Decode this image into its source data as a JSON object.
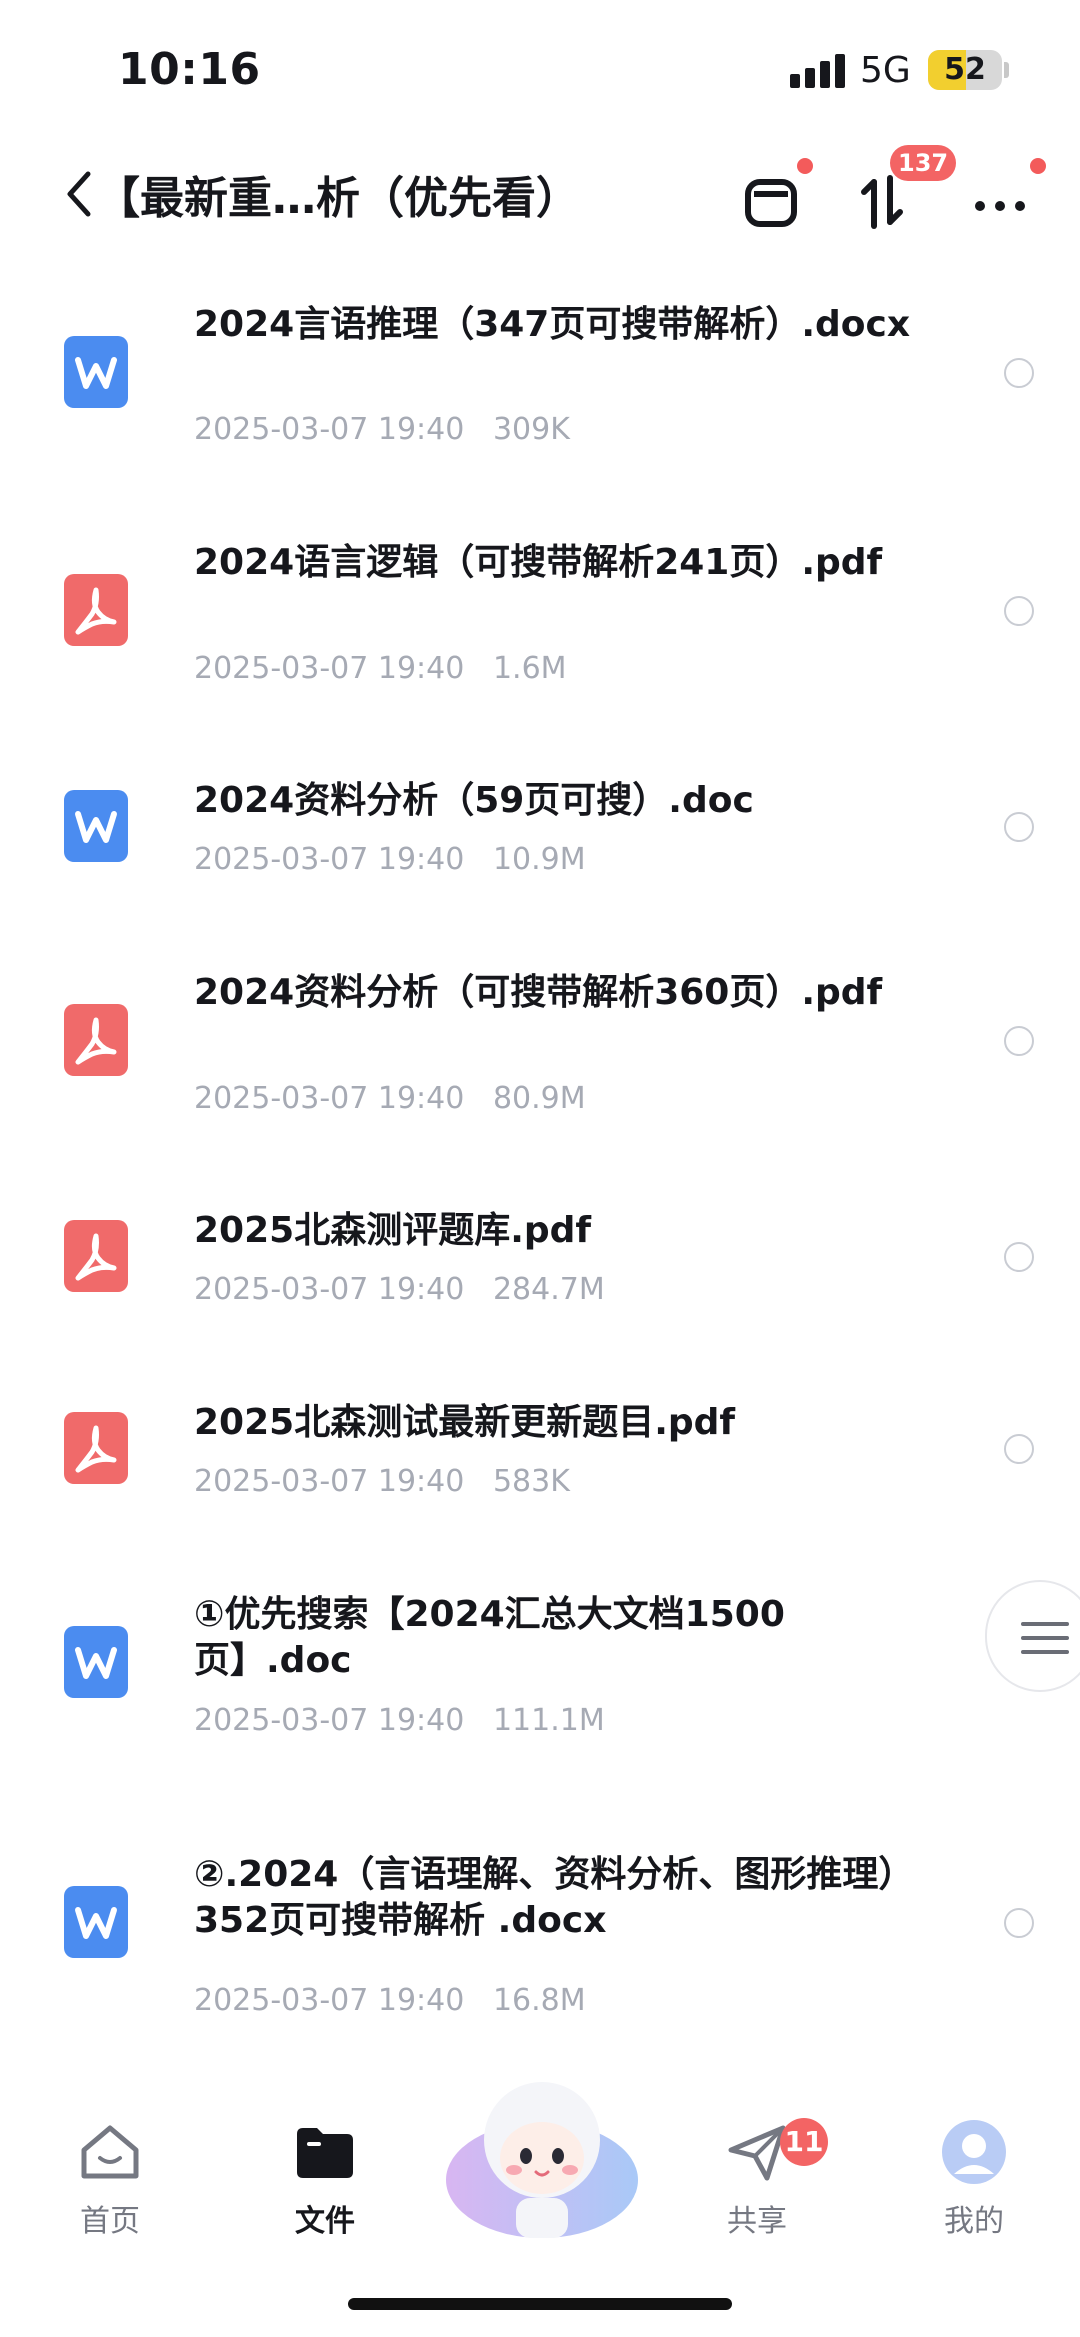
{
  "status_bar": {
    "time": "10:16",
    "network": "5G",
    "battery": "52",
    "battery_level": 0.52
  },
  "header": {
    "title": "【最新重…析（优先看）",
    "transfer_badge": "137"
  },
  "files": [
    {
      "name": "2024言语推理（347页可搜带解析）.docx",
      "date": "2025-03-07 19:40",
      "size": "309K",
      "type": "word"
    },
    {
      "name": "2024语言逻辑（可搜带解析241页）.pdf",
      "date": "2025-03-07 19:40",
      "size": "1.6M",
      "type": "pdf"
    },
    {
      "name": "2024资料分析（59页可搜）.doc",
      "date": "2025-03-07 19:40",
      "size": "10.9M",
      "type": "word"
    },
    {
      "name": "2024资料分析（可搜带解析360页）.pdf",
      "date": "2025-03-07 19:40",
      "size": "80.9M",
      "type": "pdf"
    },
    {
      "name": "2025北森测评题库.pdf",
      "date": "2025-03-07 19:40",
      "size": "284.7M",
      "type": "pdf"
    },
    {
      "name": "2025北森测试最新更新题目.pdf",
      "date": "2025-03-07 19:40",
      "size": "583K",
      "type": "pdf"
    },
    {
      "name": "①优先搜索【2024汇总大文档1500页】.doc",
      "date": "2025-03-07 19:40",
      "size": "111.1M",
      "type": "word"
    },
    {
      "name": "②.2024（言语理解、资料分析、图形推理）352页可搜带解析 .docx",
      "date": "2025-03-07 19:40",
      "size": "16.8M",
      "type": "word"
    }
  ],
  "bottom_nav": {
    "home": "首页",
    "files": "文件",
    "share": "共享",
    "share_badge": "11",
    "me": "我的"
  },
  "colors": {
    "word": "#4b8cf0",
    "pdf": "#f06a6a",
    "badge": "#f36464",
    "meta": "#a6aab4"
  }
}
